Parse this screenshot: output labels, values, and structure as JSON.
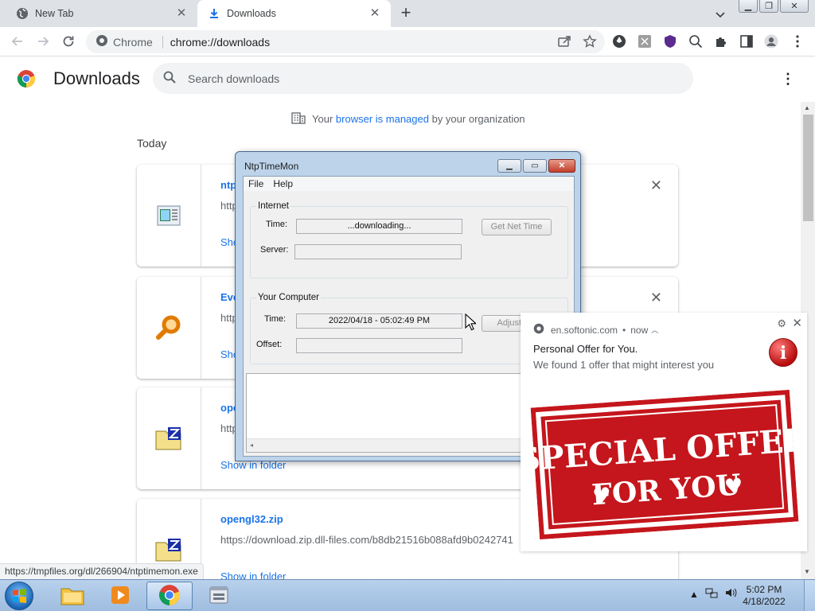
{
  "tabs": [
    {
      "label": "New Tab",
      "icon": "globe-icon",
      "active": false
    },
    {
      "label": "Downloads",
      "icon": "download-icon",
      "active": true
    }
  ],
  "toolbar": {
    "chip": "Chrome",
    "url": "chrome://downloads"
  },
  "downloads": {
    "title": "Downloads",
    "search_placeholder": "Search downloads",
    "managed_prefix": "Your",
    "managed_link": "browser is managed",
    "managed_suffix": "by your organization",
    "section": "Today",
    "items": [
      {
        "name": "ntp",
        "url": "http",
        "action": "Sho",
        "icon": "exe-file-icon"
      },
      {
        "name": "Eve",
        "url": "http",
        "action": "Sho",
        "icon": "magnifier-file-icon"
      },
      {
        "name": "ope",
        "url": "http",
        "action": "Show in folder",
        "icon": "zip-file-icon"
      },
      {
        "name": "opengl32.zip",
        "url": "https://download.zip.dll-files.com/b8db21516b088afd9b0242741",
        "action": "Show in folder",
        "icon": "zip-file-icon"
      }
    ]
  },
  "status_url": "https://tmpfiles.org/dl/266904/ntptimemon.exe",
  "dialog": {
    "title": "NtpTimeMon",
    "menu": [
      "File",
      "Help"
    ],
    "internet_label": "Internet",
    "time_label": "Time:",
    "time_value": "...downloading...",
    "server_label": "Server:",
    "server_value": "",
    "get_net_time": "Get Net Time",
    "computer_label": "Your Computer",
    "computer_time_label": "Time:",
    "computer_time_value": "2022/04/18 - 05:02:49 PM",
    "offset_label": "Offset:",
    "offset_value": "",
    "adjust_label": "Adjust PC"
  },
  "notification": {
    "source": "en.softonic.com",
    "when": "now",
    "title": "Personal Offer for You.",
    "message": "We found 1 offer that might interest you",
    "stamp_line1": "SPECIAL OFFER",
    "stamp_line2": "FOR YOU",
    "accent": "#c4161c"
  },
  "taskbar": {
    "time": "5:02 PM",
    "date": "4/18/2022"
  }
}
